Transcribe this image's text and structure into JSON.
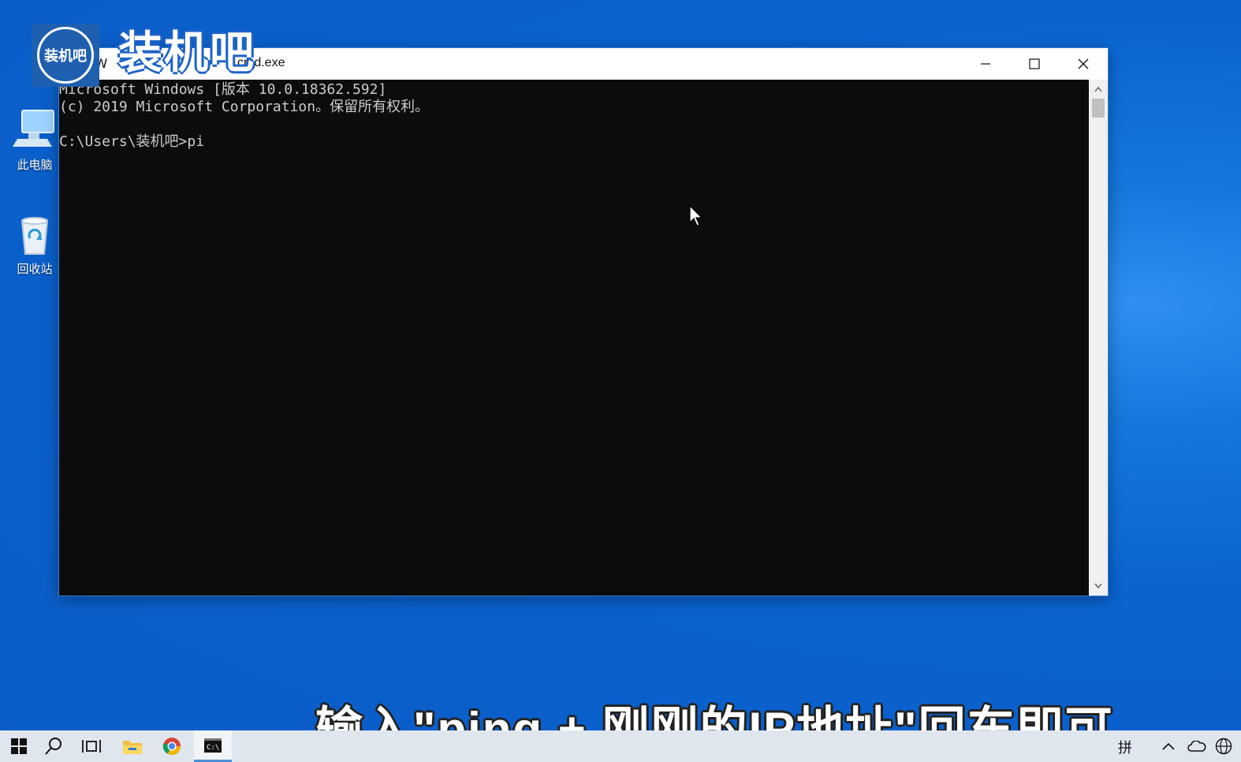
{
  "desktop": {
    "icons": [
      {
        "label": "此电脑",
        "icon": "computer-icon"
      },
      {
        "label": "回收站",
        "icon": "recycle-bin-icon"
      }
    ]
  },
  "watermark": {
    "badge_text": "装机吧",
    "logo_text": "装机吧"
  },
  "window": {
    "title_prefix": "\\W",
    "title": "cmd.exe",
    "controls": [
      "minimize-icon",
      "maximize-icon",
      "close-icon"
    ],
    "console_lines": [
      "Microsoft Windows [版本 10.0.18362.592]",
      "(c) 2019 Microsoft Corporation。保留所有权利。",
      "",
      "C:\\Users\\装机吧>pi"
    ]
  },
  "caption": "输入\"ping + 刚刚的IP地址\"回车即可",
  "taskbar": {
    "buttons": [
      "start-icon",
      "search-icon",
      "task-view-icon",
      "file-explorer-icon",
      "chrome-icon",
      "cmd-icon"
    ],
    "ime": "拼",
    "tray": [
      "chevron-up-icon",
      "onedrive-icon",
      "network-icon"
    ]
  },
  "colors": {
    "console_bg": "#0c0c0c",
    "console_fg": "#cccccc",
    "taskbar_bg": "#dfe6ee"
  }
}
